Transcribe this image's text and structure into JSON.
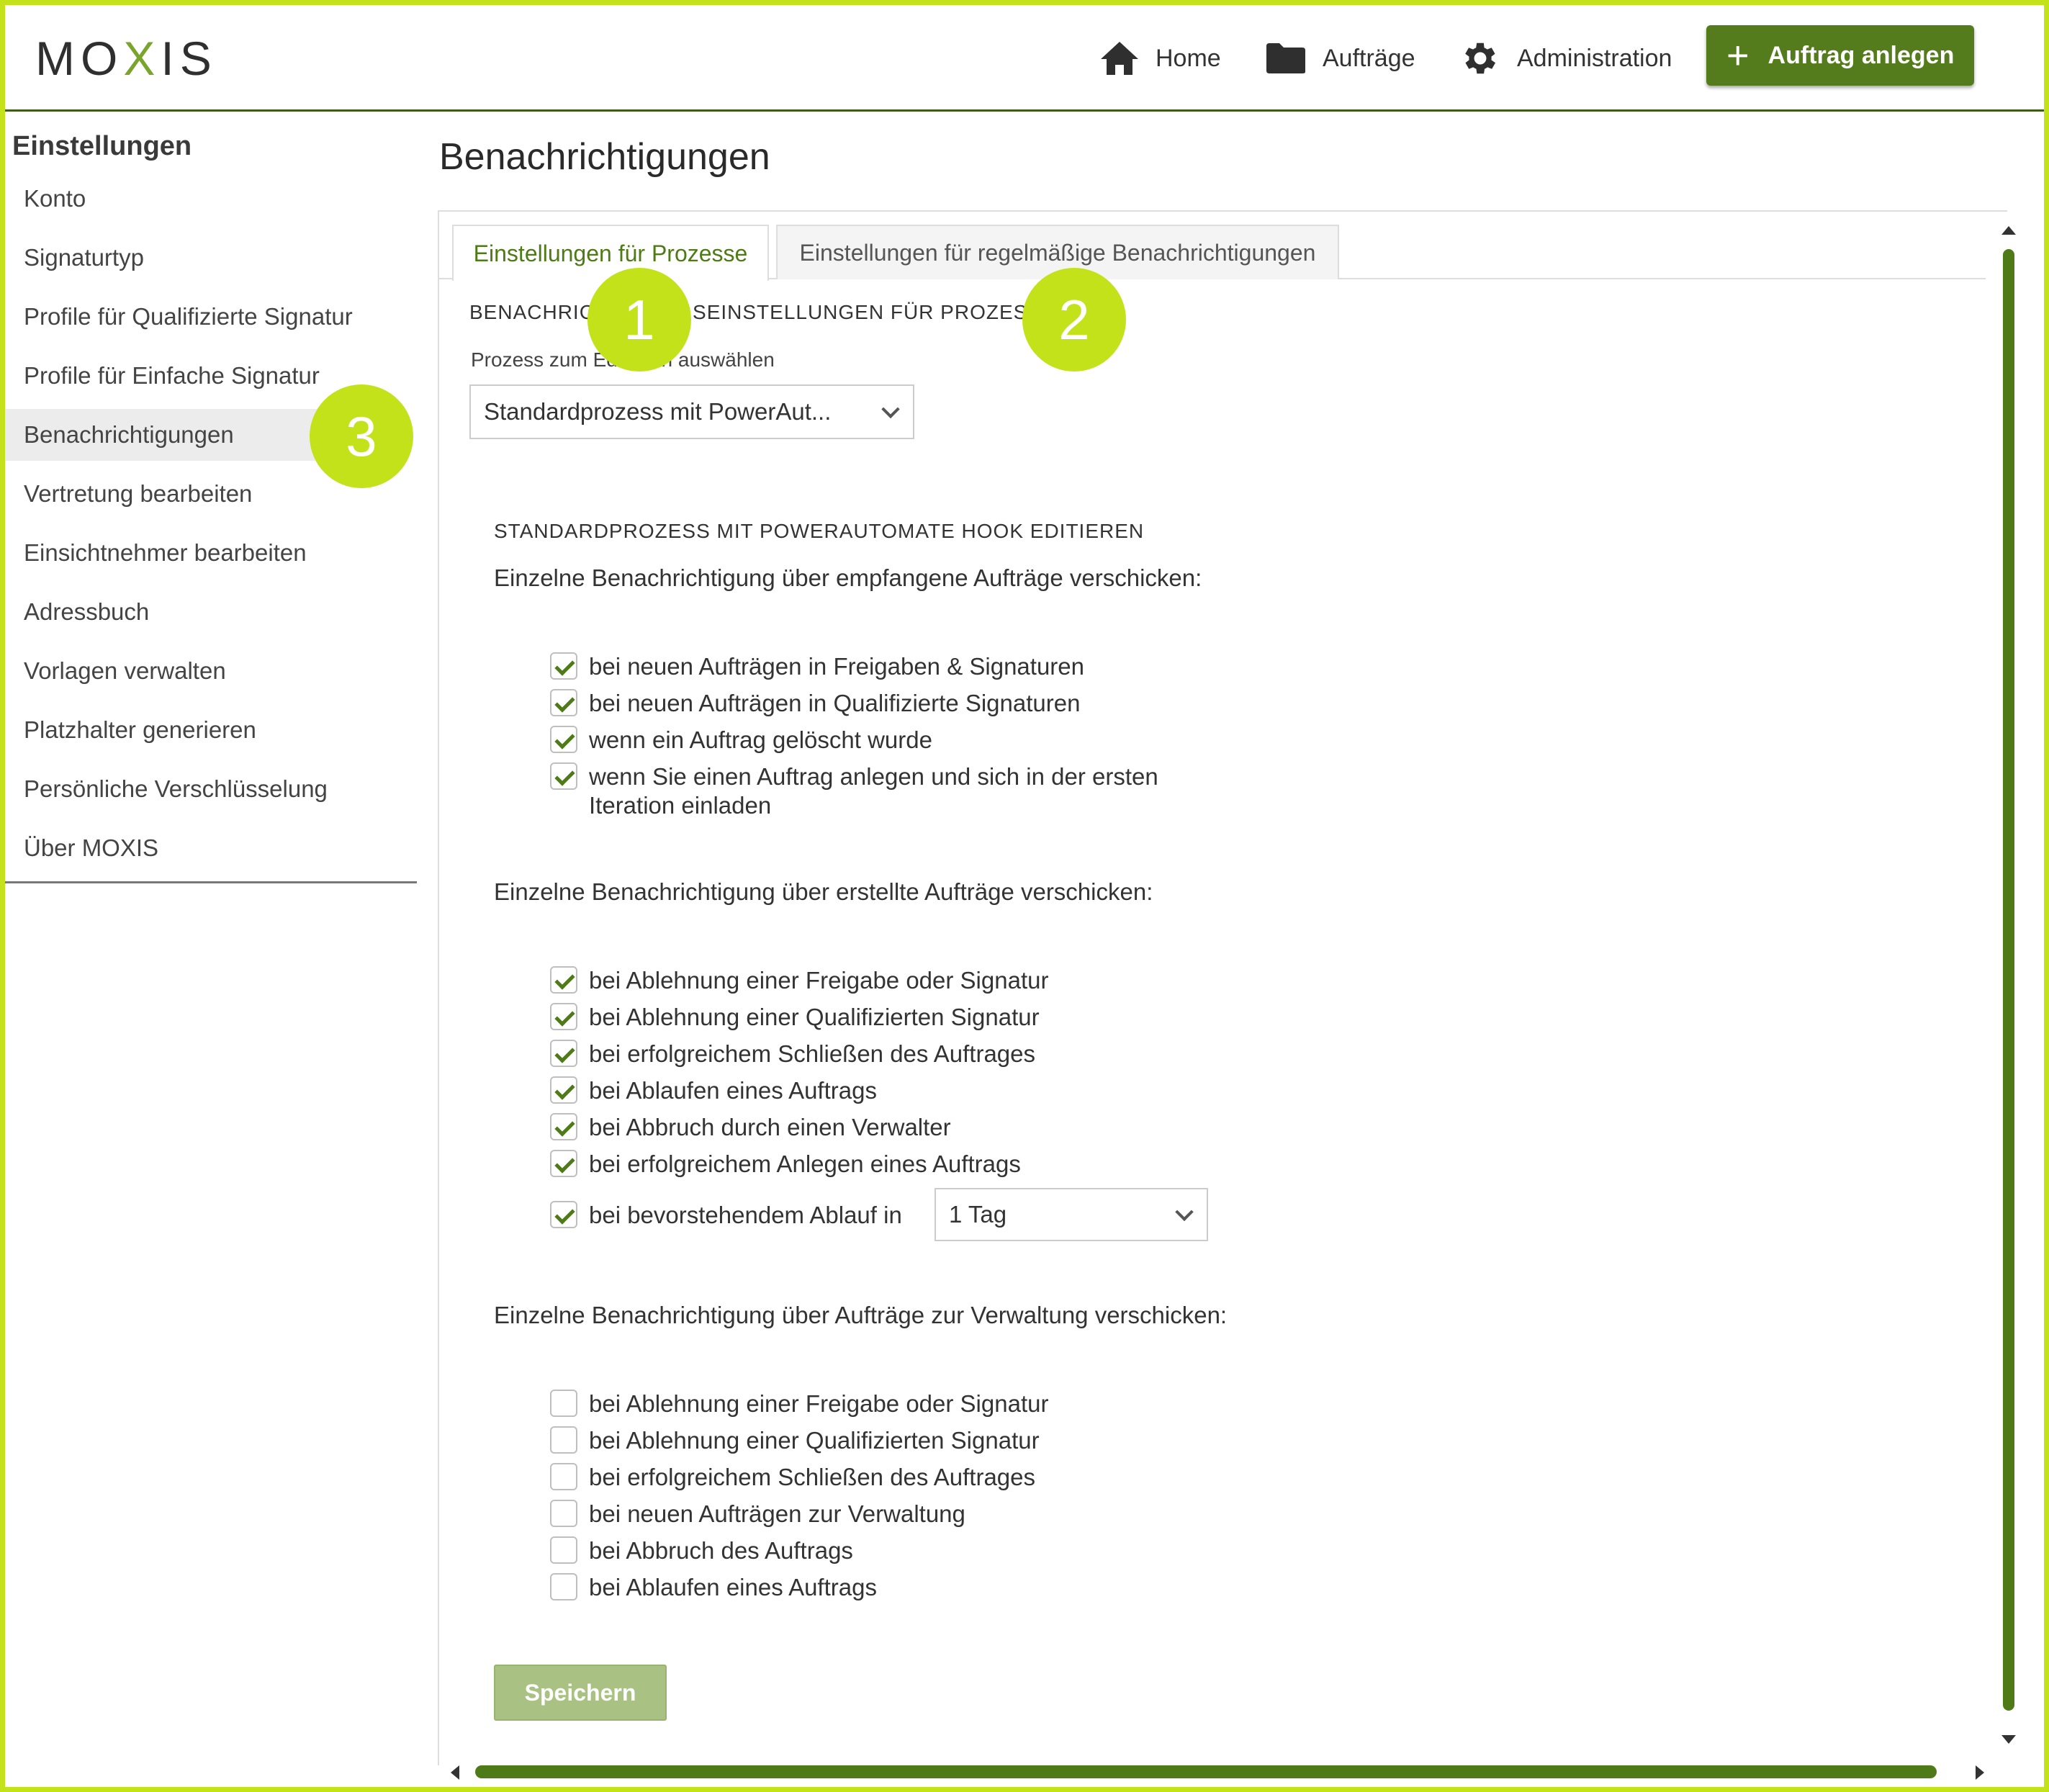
{
  "header": {
    "logo_left": "MO",
    "logo_x": "X",
    "logo_right": "IS",
    "nav": [
      {
        "label": "Home",
        "icon": "home-icon"
      },
      {
        "label": "Aufträge",
        "icon": "folder-icon"
      },
      {
        "label": "Administration",
        "icon": "gear-icon"
      }
    ],
    "create_button": {
      "plus": "+",
      "label": "Auftrag anlegen"
    },
    "accent_color": "#557c1c"
  },
  "sidebar": {
    "title": "Einstellungen",
    "items": [
      "Konto",
      "Signaturtyp",
      "Profile für Qualifizierte Signatur",
      "Profile für Einfache Signatur",
      "Benachrichtigungen",
      "Vertretung bearbeiten",
      "Einsichtnehmer bearbeiten",
      "Adressbuch",
      "Vorlagen verwalten",
      "Platzhalter generieren",
      "Persönliche Verschlüsselung",
      "Über MOXIS"
    ],
    "active_item": "Benachrichtigungen"
  },
  "main": {
    "title": "Benachrichtigungen",
    "tabs": [
      {
        "label": "Einstellungen für Prozesse",
        "active": true
      },
      {
        "label": "Einstellungen für regelmäßige Benachrichtigungen",
        "active": false
      }
    ],
    "section_heading": "BENACHRICHTIGUNGSEINSTELLUNGEN FÜR PROZESSE",
    "process_select": {
      "label": "Prozess zum Editieren auswählen",
      "value": "Standardprozess mit PowerAut..."
    },
    "edit_heading": "STANDARDPROZESS MIT POWERAUTOMATE HOOK EDITIEREN",
    "groups": [
      {
        "heading": "Einzelne Benachrichtigung über empfangene Aufträge verschicken:",
        "options": [
          {
            "label": "bei neuen Aufträgen in Freigaben & Signaturen",
            "checked": true
          },
          {
            "label": "bei neuen Aufträgen in Qualifizierte Signaturen",
            "checked": true
          },
          {
            "label": "wenn ein Auftrag gelöscht wurde",
            "checked": true
          },
          {
            "label": "wenn Sie einen Auftrag anlegen und sich in der ersten",
            "label2": "Iteration einladen",
            "checked": true
          }
        ]
      },
      {
        "heading": "Einzelne Benachrichtigung über erstellte Aufträge verschicken:",
        "options": [
          {
            "label": "bei Ablehnung einer Freigabe oder Signatur",
            "checked": true
          },
          {
            "label": "bei Ablehnung einer Qualifizierten Signatur",
            "checked": true
          },
          {
            "label": "bei erfolgreichem Schließen des Auftrages",
            "checked": true
          },
          {
            "label": "bei Ablaufen eines Auftrags",
            "checked": true
          },
          {
            "label": "bei Abbruch durch einen Verwalter",
            "checked": true
          },
          {
            "label": "bei erfolgreichem Anlegen eines Auftrags",
            "checked": true
          },
          {
            "label": "bei bevorstehendem Ablauf in",
            "checked": true,
            "select_value": "1 Tag"
          }
        ]
      },
      {
        "heading": "Einzelne Benachrichtigung über Aufträge zur Verwaltung verschicken:",
        "options": [
          {
            "label": "bei Ablehnung einer Freigabe oder Signatur",
            "checked": false
          },
          {
            "label": "bei Ablehnung einer Qualifizierten Signatur",
            "checked": false
          },
          {
            "label": "bei erfolgreichem Schließen des Auftrages",
            "checked": false
          },
          {
            "label": "bei neuen Aufträgen zur Verwaltung",
            "checked": false
          },
          {
            "label": "bei Abbruch des Auftrags",
            "checked": false
          },
          {
            "label": "bei Ablaufen eines Auftrags",
            "checked": false
          }
        ]
      }
    ],
    "save_label": "Speichern"
  },
  "badges": [
    "1",
    "2",
    "3"
  ],
  "badge_color": "#c3e21a"
}
